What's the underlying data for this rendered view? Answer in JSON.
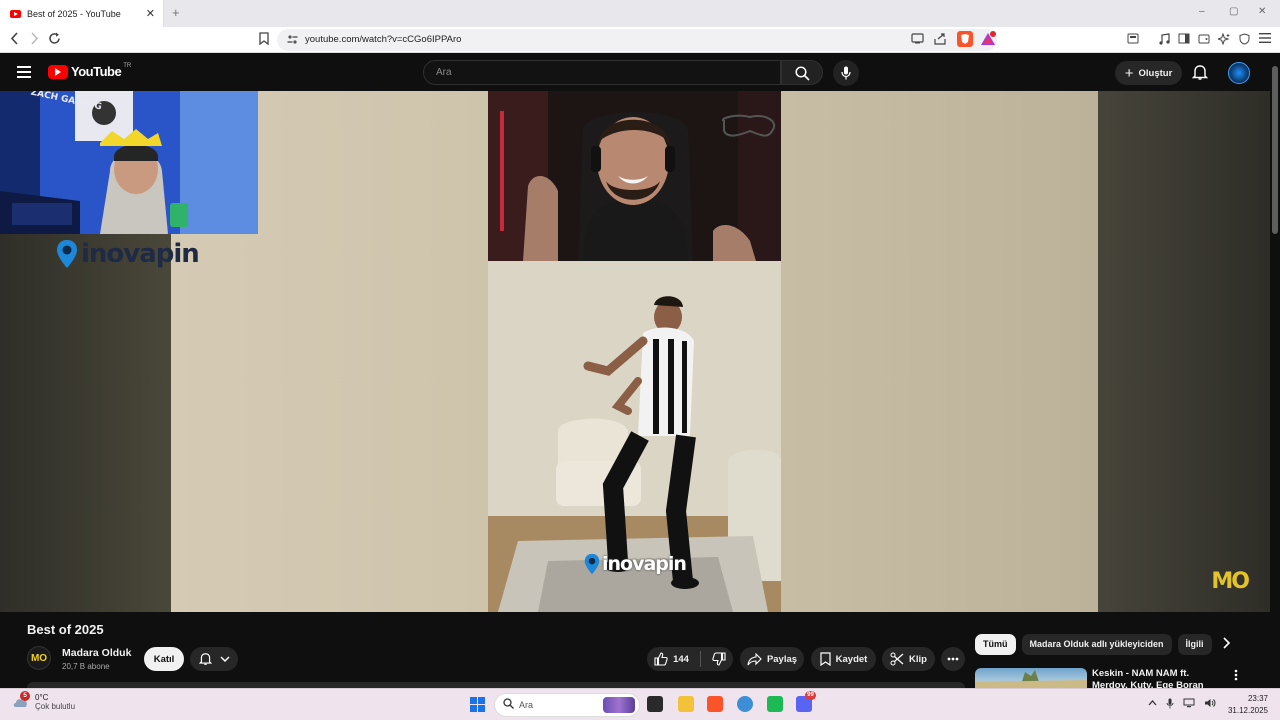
{
  "browser": {
    "tab_title": "Best of 2025 - YouTube",
    "tab_close": "✕",
    "new_tab": "+",
    "url": "youtube.com/watch?v=cCGo6IPPAro",
    "window_controls": [
      "–",
      "▢",
      "✕"
    ],
    "accent": "#fb542b"
  },
  "header": {
    "logo_text": "YouTube",
    "country_code": "TR",
    "search_placeholder": "Ara",
    "create_label": "Oluştur"
  },
  "video": {
    "watermark_text": "inovapin",
    "channel_watermark": "MO",
    "wall_text": "ZACH GAMING"
  },
  "details": {
    "title": "Best of 2025",
    "channel_initials": "MO",
    "channel_name": "Madara Olduk",
    "subscribers": "20,7 B abone",
    "join_label": "Katıl",
    "like_count": "144",
    "share_label": "Paylaş",
    "save_label": "Kaydet",
    "clip_label": "Klip"
  },
  "sidebar": {
    "chips": [
      {
        "label": "Tümü",
        "active": true
      },
      {
        "label": "Madara Olduk adlı yükleyiciden",
        "active": false
      },
      {
        "label": "İlgili",
        "active": false
      }
    ],
    "recommendation": {
      "title": "Keskin - NAM NAM ft. Merdov, Kuty, Ege Boran (Music Video)"
    }
  },
  "taskbar": {
    "weather_badge": "5",
    "temperature": "0°C",
    "weather_desc": "Çok bulutlu",
    "search_placeholder": "Ara",
    "discord_badge": "99",
    "time": "23:37",
    "date": "31.12.2025"
  }
}
